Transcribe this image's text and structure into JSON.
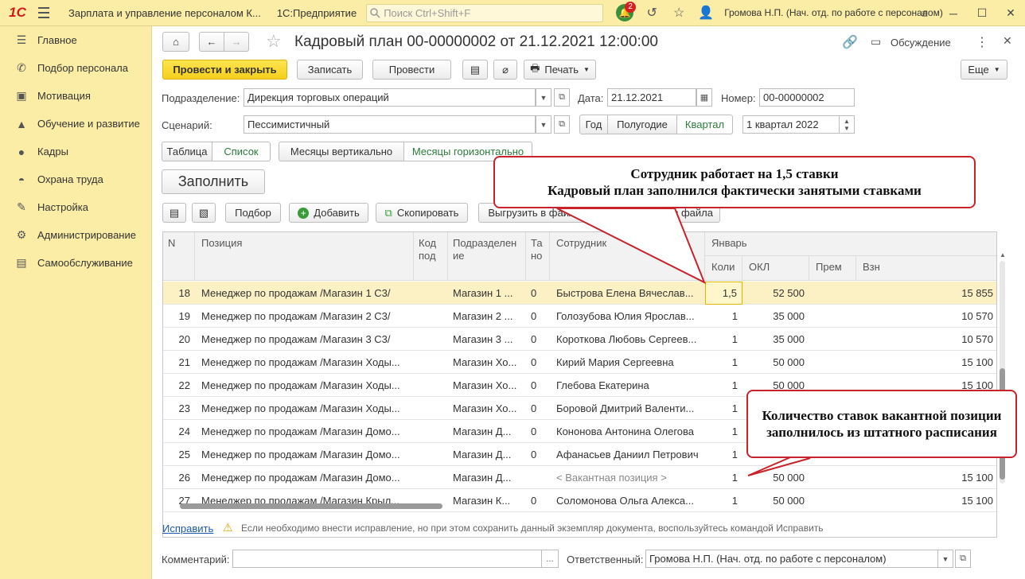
{
  "topbar": {
    "logo": "1С",
    "app_title": "Зарплата и управление персоналом К...",
    "platform": "1С:Предприятие",
    "search_placeholder": "Поиск Ctrl+Shift+F",
    "notifications_count": "2",
    "user": "Громова Н.П. (Нач. отд. по работе с персоналом)"
  },
  "sidebar": {
    "items": [
      {
        "label": "Главное",
        "icon": "menu-icon"
      },
      {
        "label": "Подбор персонала",
        "icon": "phone-icon"
      },
      {
        "label": "Мотивация",
        "icon": "gift-icon"
      },
      {
        "label": "Обучение и развитие",
        "icon": "graduation-icon"
      },
      {
        "label": "Кадры",
        "icon": "people-icon"
      },
      {
        "label": "Охрана труда",
        "icon": "helmet-icon"
      },
      {
        "label": "Настройка",
        "icon": "wrench-icon"
      },
      {
        "label": "Администрирование",
        "icon": "gear-icon"
      },
      {
        "label": "Самообслуживание",
        "icon": "id-card-icon"
      }
    ]
  },
  "document": {
    "title": "Кадровый план 00-00000002 от 21.12.2021 12:00:00",
    "discussion": "Обсуждение"
  },
  "toolbar": {
    "post_close": "Провести и закрыть",
    "save": "Записать",
    "post": "Провести",
    "print": "Печать",
    "more": "Еще"
  },
  "form": {
    "division_label": "Подразделение:",
    "division_value": "Дирекция торговых операций",
    "date_label": "Дата:",
    "date_value": "21.12.2021",
    "number_label": "Номер:",
    "number_value": "00-00000002",
    "scenario_label": "Сценарий:",
    "scenario_value": "Пессимистичный",
    "period_year": "Год",
    "period_half": "Полугодие",
    "period_quarter": "Квартал",
    "period_value": "1 квартал 2022"
  },
  "view_switch": {
    "table": "Таблица",
    "list": "Список",
    "months_vertical": "Месяцы вертикально",
    "months_horizontal": "Месяцы горизонтально"
  },
  "fill_button": "Заполнить",
  "table_toolbar": {
    "select": "Подбор",
    "add": "Добавить",
    "copy": "Скопировать",
    "export": "Выгрузить в файл",
    "import": "ть из файла"
  },
  "table": {
    "headers": {
      "n": "N",
      "position": "Позиция",
      "code": "Код под",
      "division": "Подразделен ие",
      "ta": "Та но",
      "employee": "Сотрудник",
      "month": "Январь",
      "qty": "Коли",
      "okl": "ОКЛ",
      "prem": "Прем",
      "vzn": "Взн"
    },
    "rows": [
      {
        "n": "18",
        "position": "Менеджер по продажам /Магазин 1 С3/",
        "code": "",
        "division": "Магазин 1 ...",
        "ta": "0",
        "employee": "Быстрова Елена Вячеслав...",
        "qty": "1,5",
        "okl": "52 500",
        "prem": "",
        "vzn": "15 855"
      },
      {
        "n": "19",
        "position": "Менеджер по продажам /Магазин 2 С3/",
        "code": "",
        "division": "Магазин 2 ...",
        "ta": "0",
        "employee": "Голозубова Юлия Ярослав...",
        "qty": "1",
        "okl": "35 000",
        "prem": "",
        "vzn": "10 570"
      },
      {
        "n": "20",
        "position": "Менеджер по продажам /Магазин 3 С3/",
        "code": "",
        "division": "Магазин 3 ...",
        "ta": "0",
        "employee": "Короткова Любовь Сергеев...",
        "qty": "1",
        "okl": "35 000",
        "prem": "",
        "vzn": "10 570"
      },
      {
        "n": "21",
        "position": "Менеджер по продажам /Магазин Ходы...",
        "code": "",
        "division": "Магазин Хо...",
        "ta": "0",
        "employee": "Кирий Мария Сергеевна",
        "qty": "1",
        "okl": "50 000",
        "prem": "",
        "vzn": "15 100"
      },
      {
        "n": "22",
        "position": "Менеджер по продажам /Магазин Ходы...",
        "code": "",
        "division": "Магазин Хо...",
        "ta": "0",
        "employee": "Глебова Екатерина",
        "qty": "1",
        "okl": "50 000",
        "prem": "",
        "vzn": "15 100"
      },
      {
        "n": "23",
        "position": "Менеджер по продажам /Магазин Ходы...",
        "code": "",
        "division": "Магазин Хо...",
        "ta": "0",
        "employee": "Боровой Дмитрий Валенти...",
        "qty": "1",
        "okl": "",
        "prem": "",
        "vzn": ""
      },
      {
        "n": "24",
        "position": "Менеджер по продажам /Магазин Домо...",
        "code": "",
        "division": "Магазин Д...",
        "ta": "0",
        "employee": "Кононова Антонина Олегова",
        "qty": "1",
        "okl": "",
        "prem": "",
        "vzn": ""
      },
      {
        "n": "25",
        "position": "Менеджер по продажам /Магазин Домо...",
        "code": "",
        "division": "Магазин Д...",
        "ta": "0",
        "employee": "Афанасьев Даниил Петрович",
        "qty": "1",
        "okl": "",
        "prem": "",
        "vzn": ""
      },
      {
        "n": "26",
        "position": "Менеджер по продажам /Магазин Домо...",
        "code": "",
        "division": "Магазин Д...",
        "ta": "",
        "employee": "< Вакантная позиция >",
        "qty": "1",
        "okl": "50 000",
        "prem": "",
        "vzn": "15 100"
      },
      {
        "n": "27",
        "position": "Менеджер по продажам /Магазин Крыл...",
        "code": "",
        "division": "Магазин К...",
        "ta": "0",
        "employee": "Соломонова Ольга Алекса...",
        "qty": "1",
        "okl": "50 000",
        "prem": "",
        "vzn": "15 100"
      }
    ]
  },
  "callouts": {
    "top_line1": "Сотрудник работает на 1,5 ставки",
    "top_line2": "Кадровый план заполнился фактически занятыми ставками",
    "bottom": "Количество ставок вакантной позиции заполнилось из штатного расписания"
  },
  "footer": {
    "fix_link": "Исправить",
    "fix_hint": "Если необходимо внести исправление, но при этом сохранить данный экземпляр документа, воспользуйтесь командой Исправить",
    "comment_label": "Комментарий:",
    "responsible_label": "Ответственный:",
    "responsible_value": "Громова Н.П. (Нач. отд. по работе с персоналом)"
  },
  "colors": {
    "accent_yellow": "#f5cf1b",
    "panel_yellow": "#fbeda6",
    "callout_red": "#c8232c",
    "link_green": "#2a7d3a"
  }
}
